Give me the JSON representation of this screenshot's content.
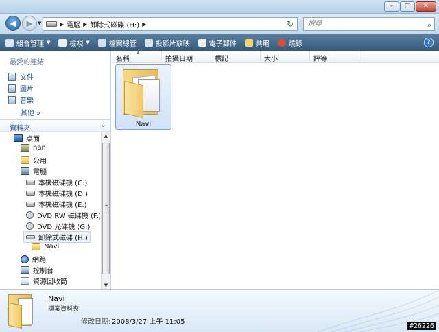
{
  "window": {
    "title": "",
    "minimize": "–",
    "maximize": "□",
    "close": "✕"
  },
  "address": {
    "crumbs": [
      "電腦",
      "卸除式磁碟 (H:)"
    ],
    "search_placeholder": "搜尋"
  },
  "toolbar": {
    "items": [
      {
        "label": "組合管理",
        "icon": "organize-icon"
      },
      {
        "label": "檢視",
        "icon": "views-icon"
      },
      {
        "label": "檔案總管",
        "icon": "explorer-icon"
      },
      {
        "label": "投影片放映",
        "icon": "slideshow-icon"
      },
      {
        "label": "電子郵件",
        "icon": "email-icon"
      },
      {
        "label": "共用",
        "icon": "share-icon"
      },
      {
        "label": "燒錄",
        "icon": "burn-icon"
      }
    ],
    "help": "?"
  },
  "favorites": {
    "title": "最愛的連結",
    "items": [
      "文件",
      "圖片",
      "音樂"
    ],
    "more": "其他 »"
  },
  "folders": {
    "title": "資料夾",
    "tree": [
      {
        "label": "桌面",
        "icon": "desktop-icon"
      },
      {
        "label": "han",
        "icon": "user-icon"
      },
      {
        "label": "公用",
        "icon": "folder-icon"
      },
      {
        "label": "電腦",
        "icon": "computer-icon"
      },
      {
        "label": "本機磁碟機 (C:)",
        "icon": "drive-icon"
      },
      {
        "label": "本機磁碟機 (D:)",
        "icon": "drive-icon"
      },
      {
        "label": "本機磁碟機 (E:)",
        "icon": "drive-icon"
      },
      {
        "label": "DVD RW 磁碟機 (F:) N",
        "icon": "dvd-icon"
      },
      {
        "label": "DVD 光碟機 (G:)",
        "icon": "dvd-icon"
      },
      {
        "label": "卸除式磁碟 (H:)",
        "icon": "usb-drive-icon"
      },
      {
        "label": "Navi",
        "icon": "folder-icon"
      },
      {
        "label": "網路",
        "icon": "network-icon"
      },
      {
        "label": "控制台",
        "icon": "control-panel-icon"
      },
      {
        "label": "資源回收筒",
        "icon": "recycle-bin-icon"
      }
    ]
  },
  "columns": [
    "名稱",
    "拍攝日期",
    "標記",
    "大小",
    "評等"
  ],
  "files": [
    {
      "name": "Navi",
      "icon": "folder-icon"
    }
  ],
  "details": {
    "name": "Navi",
    "type": "檔案資料夾",
    "modified_label": "修改日期:",
    "modified_value": "2008/3/27 上午 11:05"
  },
  "watermark": "#26226"
}
